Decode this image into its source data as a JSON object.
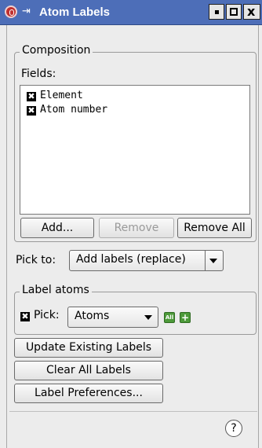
{
  "window": {
    "title": "Atom Labels",
    "pin_glyph": "⇥",
    "close_glyph": "x"
  },
  "composition": {
    "legend": "Composition",
    "fields_label": "Fields:",
    "fields": [
      {
        "label": "Element",
        "checked": true
      },
      {
        "label": "Atom number",
        "checked": true
      }
    ],
    "add_label": "Add...",
    "remove_label": "Remove",
    "remove_all_label": "Remove All"
  },
  "pick_to": {
    "label": "Pick to:",
    "value": "Add labels (replace)"
  },
  "label_atoms": {
    "legend": "Label atoms",
    "pick_label": "Pick:",
    "pick_checked": true,
    "pick_value": "Atoms",
    "all_icon_text": "All",
    "plus_icon_text": "+"
  },
  "actions": {
    "update_existing": "Update Existing Labels",
    "clear_all": "Clear All Labels",
    "label_preferences": "Label Preferences..."
  },
  "help": {
    "glyph": "?"
  },
  "colors": {
    "titlebar": "#4d6eb8",
    "background": "#ececec",
    "accent_green": "#4d9a3a"
  }
}
